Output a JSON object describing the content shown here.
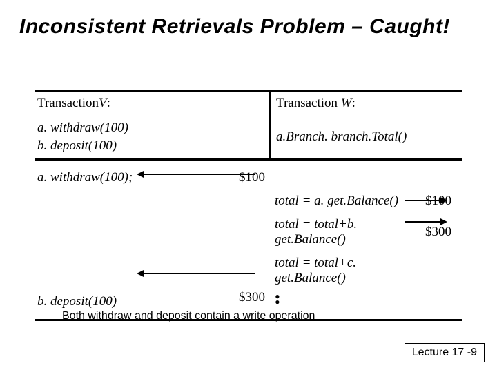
{
  "title": "Inconsistent Retrievals Problem – Caught!",
  "header": {
    "left_prefix": "Transaction",
    "left_var": "V",
    "left_colon": ":",
    "right_prefix": "Transaction ",
    "right_var": "W",
    "right_colon": ":"
  },
  "summary": {
    "left_line1": "a. withdraw(100)",
    "left_line2": "b. deposit(100)",
    "right_line1": "a.Branch. branch.Total()"
  },
  "rows": {
    "r1_left": "a. withdraw(100);",
    "r1_mid": "$100",
    "r2_right": "total = a. get.Balance()",
    "r2_val": "$100",
    "r3_right": "total = total+b. get.Balance()",
    "r3_val": "$300",
    "r4_right": "total = total+c. get.Balance()",
    "r5_left": "b. deposit(100)",
    "r5_mid": "$300"
  },
  "note": "Both withdraw and deposit contain a write operation",
  "footer": "Lecture 17 -9"
}
